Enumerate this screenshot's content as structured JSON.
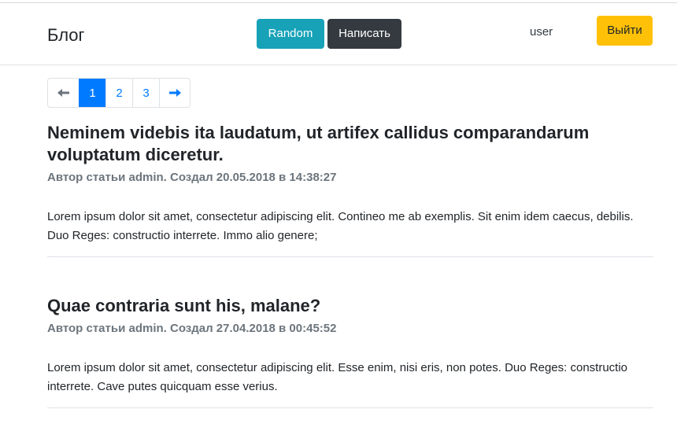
{
  "header": {
    "brand": "Блог",
    "random_label": "Random",
    "write_label": "Написать",
    "username": "user",
    "logout_label": "Выйти"
  },
  "pagination": {
    "prev_icon": "arrow-left-icon",
    "pages": [
      "1",
      "2",
      "3"
    ],
    "active_page": "1",
    "next_icon": "arrow-right-icon"
  },
  "posts": [
    {
      "title": "Neminem videbis ita laudatum, ut artifex callidus comparandarum voluptatum diceretur.",
      "meta": "Автор статьи admin. Создал 20.05.2018 в 14:38:27",
      "text": "Lorem ipsum dolor sit amet, consectetur adipiscing elit. Contineo me ab exemplis. Sit enim idem caecus, debilis. Duo Reges: constructio interrete. Immo alio genere;"
    },
    {
      "title": "Quae contraria sunt his, malane?",
      "meta": "Автор статьи admin. Создал 27.04.2018 в 00:45:52",
      "text": "Lorem ipsum dolor sit amet, consectetur adipiscing elit. Esse enim, nisi eris, non potes. Duo Reges: constructio interrete. Cave putes quicquam esse verius."
    }
  ],
  "colors": {
    "random": "#17a2b8",
    "write": "#343a40",
    "logout": "#ffc107",
    "active_page": "#007bff",
    "muted": "#6c757d"
  }
}
